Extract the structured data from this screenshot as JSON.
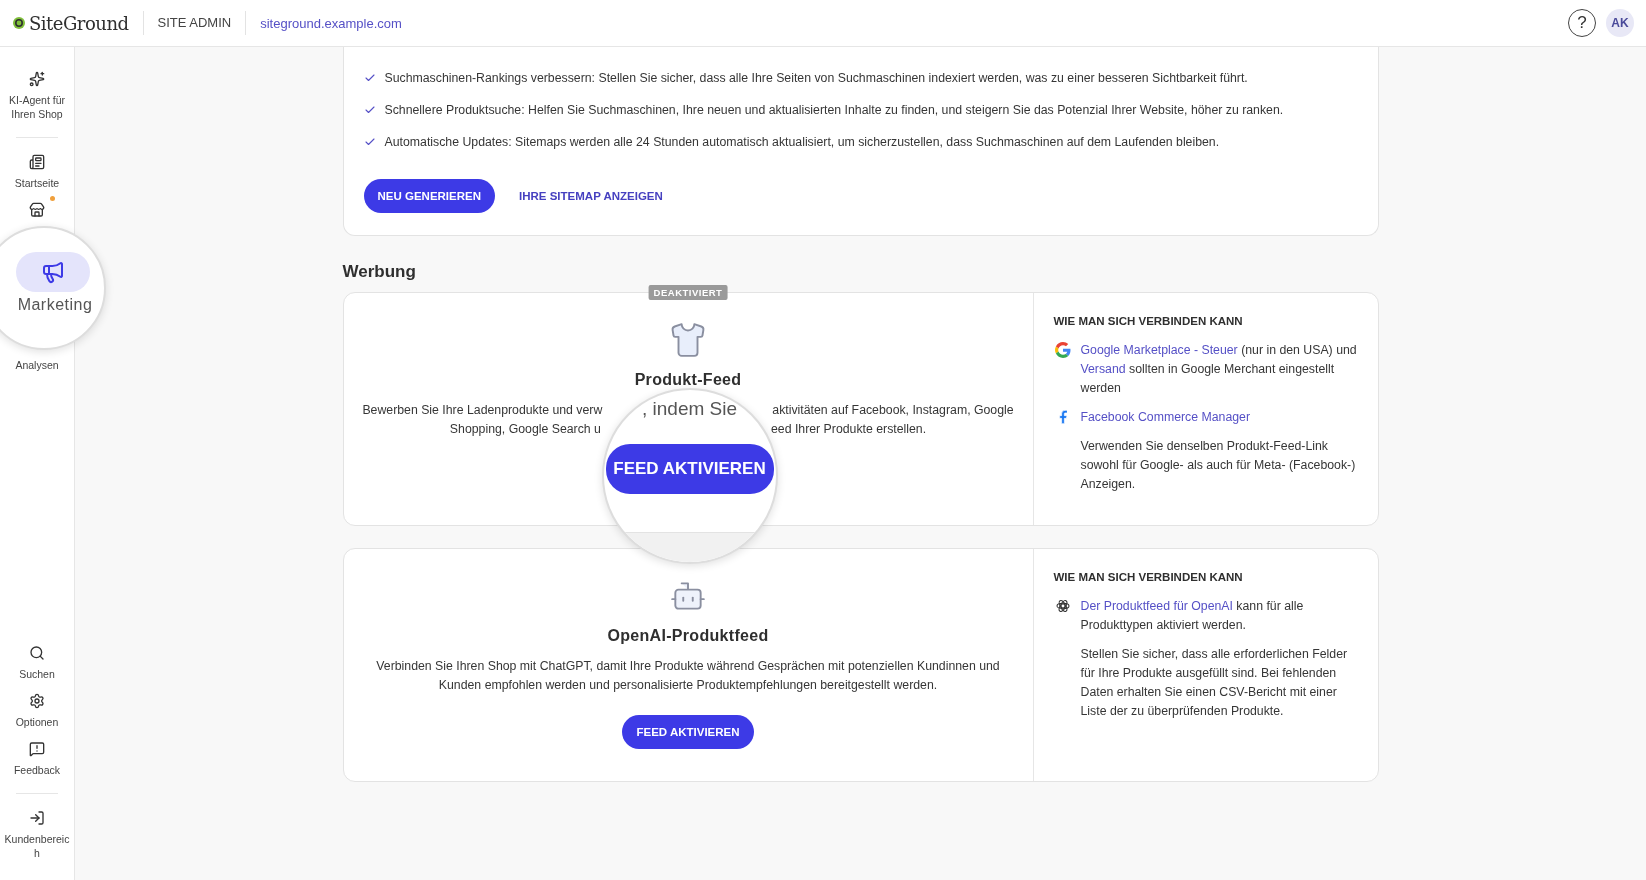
{
  "header": {
    "logo": "SiteGround",
    "section": "SITE ADMIN",
    "domain": "siteground.example.com",
    "help": "?",
    "avatar": "AK"
  },
  "sidebar": {
    "top_items": [
      {
        "kind": "sparkles",
        "label": "KI-Agent für Ihren Shop",
        "selected": false
      },
      {
        "kind": "home",
        "label": "Startseite",
        "selected": false
      },
      {
        "kind": "store",
        "selected": false,
        "badge": true
      },
      {
        "kind": "megaphone",
        "label": "Marketing",
        "selected": true
      },
      {
        "label": "Analysen",
        "selected": false
      }
    ],
    "bottom_items": [
      {
        "kind": "search",
        "label": "Suchen"
      },
      {
        "kind": "gear",
        "label": "Optionen"
      },
      {
        "kind": "feedback",
        "label": "Feedback"
      },
      {
        "kind": "exit",
        "label": "Kundenbereich",
        "divider_before": true
      }
    ]
  },
  "sitemap": {
    "bullets": [
      "Suchmaschinen-Rankings verbessern: Stellen Sie sicher, dass alle Ihre Seiten von Suchmaschinen indexiert werden, was zu einer besseren Sichtbarkeit führt.",
      "Schnellere Produktsuche: Helfen Sie Suchmaschinen, Ihre neuen und aktualisierten Inhalte zu finden, und steigern Sie das Potenzial Ihrer Website, höher zu ranken.",
      "Automatische Updates: Sitemaps werden alle 24 Stunden automatisch aktualisiert, um sicherzustellen, dass Suchmaschinen auf dem Laufenden bleiben."
    ],
    "primary_button": "NEU GENERIEREN",
    "link_button": "IHRE SITEMAP ANZEIGEN"
  },
  "section_title": "Werbung",
  "feeds": [
    {
      "kind": "shirt",
      "badge": "DEAKTIVIERT",
      "title": "Produkt-Feed",
      "description_lines": [
        [
          "Bewerben Sie Ihre Ladenprodukte und verw",
          "aktivitäten auf Facebook, Instagram, Google"
        ],
        [
          "Shopping, Google Search u",
          "eed Ihrer Produkte erstellen."
        ]
      ],
      "magnifier": {
        "text": ", indem Sie",
        "button": "FEED AKTIVIEREN"
      },
      "connect": {
        "title": "WIE MAN SICH VERBINDEN KANN",
        "entries": [
          {
            "kind": "google",
            "parts": [
              {
                "text": "Google Marketplace - Steuer",
                "link": true
              },
              {
                "text": " (nur in den USA) und ",
                "link": false
              },
              {
                "text": "Versand",
                "link": true
              },
              {
                "text": " sollten in Google Merchant eingestellt werden",
                "link": false
              }
            ]
          },
          {
            "kind": "facebook",
            "parts": [
              {
                "text": "Facebook Commerce Manager",
                "link": true
              }
            ]
          },
          {
            "parts": [
              {
                "text": "Verwenden Sie denselben Produkt-Feed-Link sowohl für Google- als auch für Meta- (Facebook-) Anzeigen.",
                "link": false
              }
            ]
          }
        ]
      }
    },
    {
      "kind": "robot",
      "title": "OpenAI-Produktfeed",
      "description": "Verbinden Sie Ihren Shop mit ChatGPT, damit Ihre Produkte während Gesprächen mit potenziellen Kundinnen und Kunden empfohlen werden und personalisierte Produktempfehlungen bereitgestellt werden.",
      "button": "FEED AKTIVIEREN",
      "connect": {
        "title": "WIE MAN SICH VERBINDEN KANN",
        "entries": [
          {
            "kind": "openai",
            "parts": [
              {
                "text": "Der Produktfeed für OpenAI",
                "link": true
              },
              {
                "text": " kann für alle Produkttypen aktiviert werden.",
                "link": false
              }
            ]
          },
          {
            "parts": [
              {
                "text": "Stellen Sie sicher, dass alle erforderlichen Felder für Ihre Produkte ausgefüllt sind. Bei fehlenden Daten erhalten Sie einen CSV-Bericht mit einer Liste der zu überprüfenden Produkte.",
                "link": false
              }
            ]
          }
        ]
      }
    }
  ]
}
